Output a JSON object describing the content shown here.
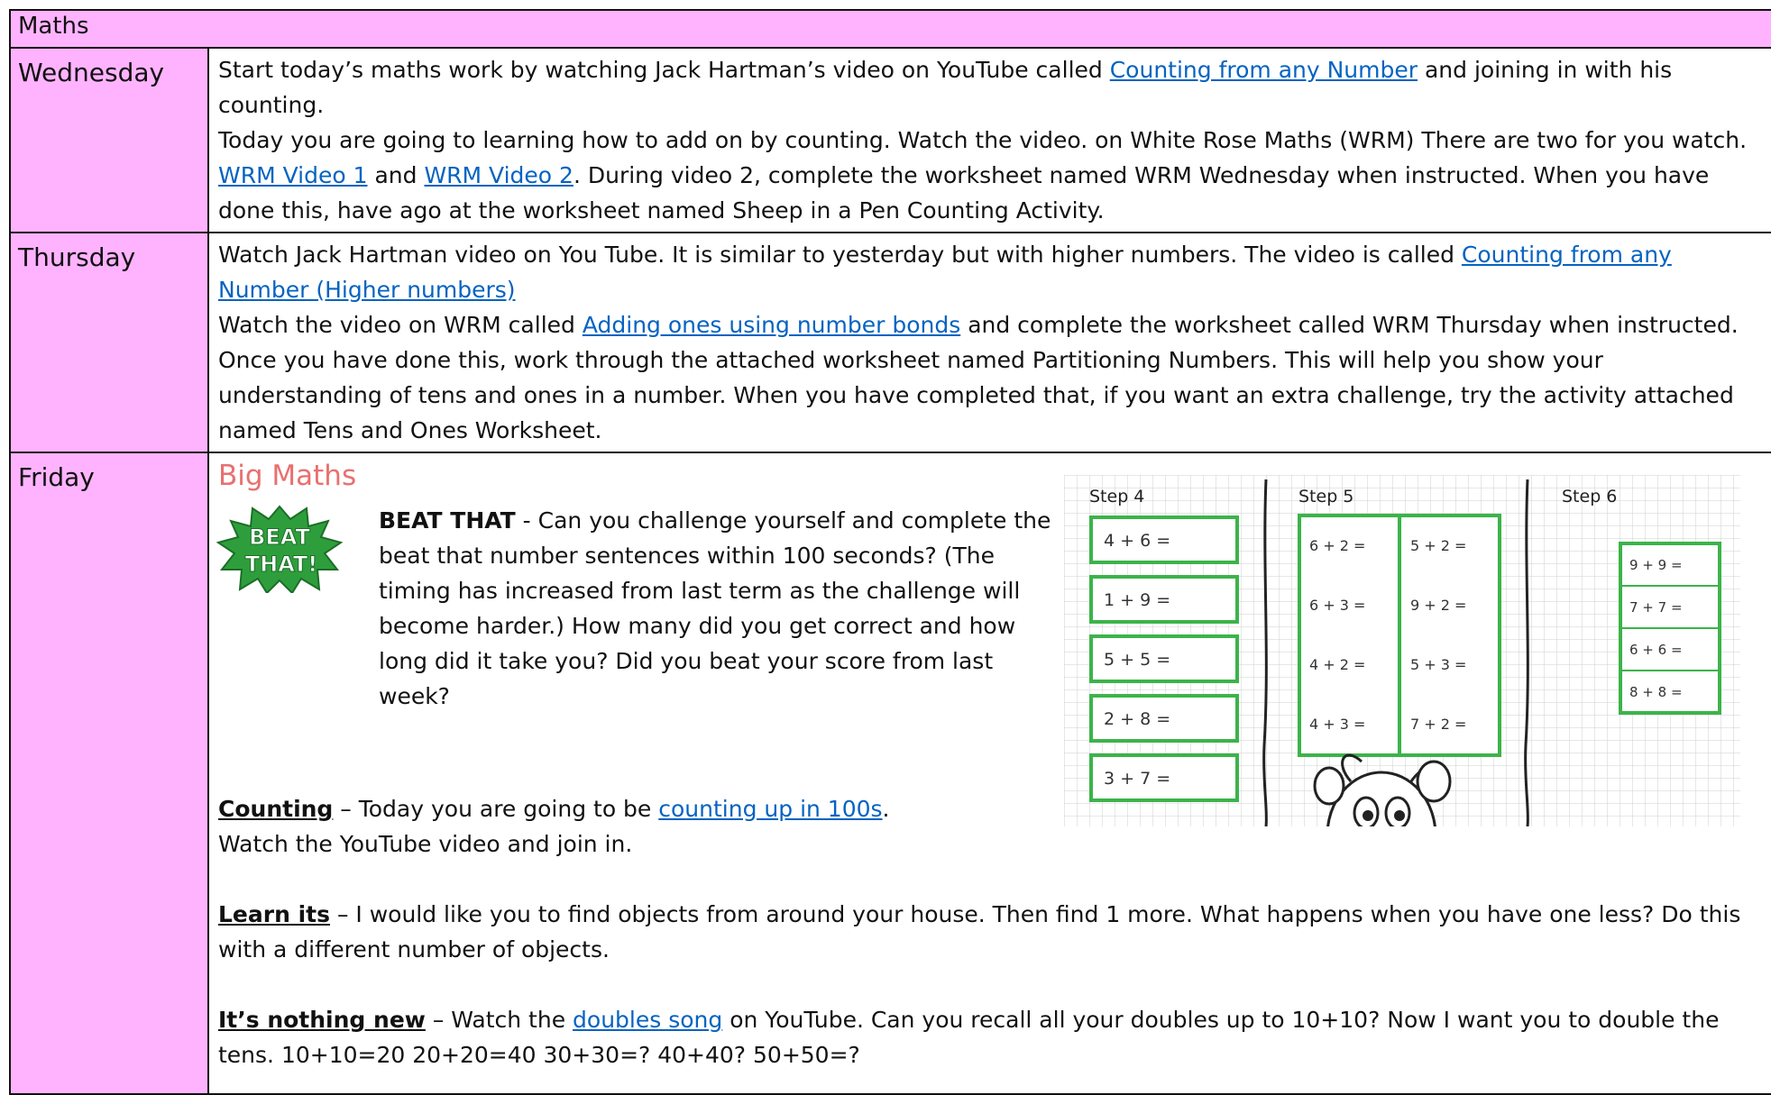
{
  "header": {
    "title": "Maths"
  },
  "wednesday": {
    "day": "Wednesday",
    "p1_a": "Start today’s maths work by watching Jack Hartman’s video on YouTube called ",
    "p1_link": "Counting from any Number",
    "p1_b": " and joining in with his counting.",
    "p2_a": "Today you are going to learning how to add on by counting. Watch the video. on White Rose Maths (WRM) There are two for you watch. ",
    "p2_link1": "WRM Video 1",
    "p2_mid": " and ",
    "p2_link2": "WRM Video 2",
    "p2_b": ". During video 2, complete the worksheet named WRM Wednesday when instructed. When you have done this, have ago at the worksheet named Sheep in a Pen Counting Activity."
  },
  "thursday": {
    "day": "Thursday",
    "p1_a": "Watch Jack Hartman video on You Tube. It is similar to yesterday but with higher numbers. The video is called ",
    "p1_link": "Counting from any Number (Higher numbers)",
    "p2_a": "Watch the video on WRM called ",
    "p2_link": "Adding ones using number bonds",
    "p2_b": " and complete the worksheet called WRM Thursday when instructed. Once you have done this, work through the attached worksheet named Partitioning Numbers. This will help you show your understanding of tens and ones in a number. When you have completed that, if you want an extra challenge, try the activity attached named Tens and Ones Worksheet."
  },
  "friday": {
    "day": "Friday",
    "heading": "Big Maths",
    "logo": {
      "top": "BEAT",
      "bottom": "THAT!",
      "icon": "beat-that-logo"
    },
    "beat_bold": "BEAT THAT",
    "beat_a": " - Can you challenge yourself and complete the beat that number sentences within 100 seconds? (The timing has increased from last term as the challenge will become harder.) How many did you get correct and how long did it take you? Did you beat your score from last week?",
    "counting_label": "Counting",
    "counting_a": " – Today you are going to be ",
    "counting_link": "counting up in 100s",
    "counting_b": ".",
    "counting_c": "Watch the YouTube video and join in.",
    "learn_label": "Learn its",
    "learn_a": " – I would like you to find objects from around your house. Then find 1 more. What happens when you have one less? Do this with a different number of objects.",
    "new_label": "It’s nothing new",
    "new_a": " – Watch the ",
    "new_link": "doubles song",
    "new_b": " on YouTube. Can you recall all your doubles up to 10+10? Now I want you to double the tens. 10+10=20 20+20=40 30+30=? 40+40? 50+50=?",
    "steps": {
      "step4": {
        "label": "Step 4",
        "items": [
          "4 + 6 =",
          "1 + 9 =",
          "5 + 5 =",
          "2 + 8 =",
          "3 + 7 ="
        ]
      },
      "step5": {
        "label": "Step 5",
        "left": [
          "6 + 2 =",
          "6 + 3 =",
          "4 + 2 =",
          "4 + 3 ="
        ],
        "right": [
          "5 + 2 =",
          "9 + 2 =",
          "5 + 3 =",
          "7 + 2 ="
        ]
      },
      "step6": {
        "label": "Step 6",
        "items": [
          "9 + 9 =",
          "7 + 7 =",
          "6 + 6 =",
          "8 + 8 ="
        ]
      },
      "border_color": "#3cb34a"
    }
  }
}
